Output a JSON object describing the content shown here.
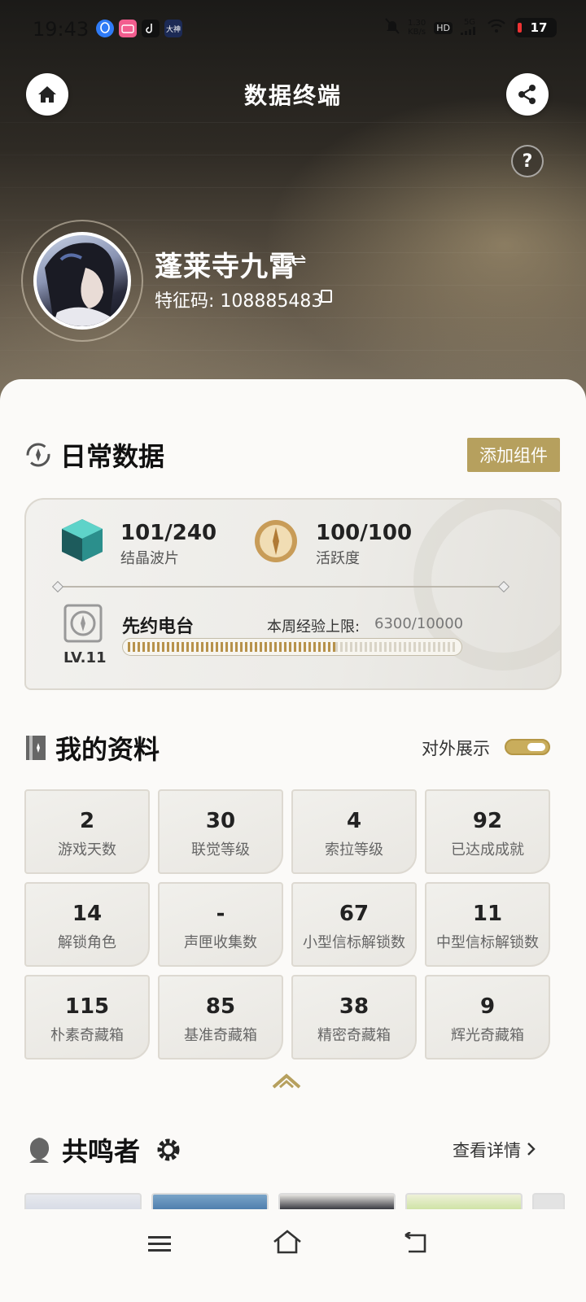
{
  "status_bar": {
    "time": "19:43",
    "net_speed_value": "1.30",
    "net_speed_unit": "KB/s",
    "hd": "HD",
    "signal": "5G",
    "battery": "17",
    "apps": [
      "qq-icon",
      "bilibili-icon",
      "tiktok-icon",
      "dashen-icon"
    ],
    "app_dashen_label": "大神"
  },
  "header": {
    "title": "数据终端",
    "help_label": "?",
    "username": "蓬莱寺九霄",
    "swap_glyph": "⇌",
    "uid_text": "特征码: 108885483"
  },
  "daily": {
    "title": "日常数据",
    "add_widget_label": "添加组件",
    "crystal_value": "101/240",
    "crystal_label": "结晶波片",
    "activity_value": "100/100",
    "activity_label": "活跃度",
    "radio_name": "先约电台",
    "weekly_exp_label": "本周经验上限:",
    "weekly_exp_value": "6300/10000",
    "weekly_exp_fraction": 0.63,
    "level": "LV.11"
  },
  "profile": {
    "title": "我的资料",
    "display_toggle_label": "对外展示",
    "display_toggle_on": true,
    "tiles": [
      {
        "value": "2",
        "label": "游戏天数"
      },
      {
        "value": "30",
        "label": "联觉等级"
      },
      {
        "value": "4",
        "label": "索拉等级"
      },
      {
        "value": "92",
        "label": "已达成成就"
      },
      {
        "value": "14",
        "label": "解锁角色"
      },
      {
        "value": "-",
        "label": "声匣收集数"
      },
      {
        "value": "67",
        "label": "小型信标解锁数"
      },
      {
        "value": "11",
        "label": "中型信标解锁数"
      },
      {
        "value": "115",
        "label": "朴素奇藏箱"
      },
      {
        "value": "85",
        "label": "基准奇藏箱"
      },
      {
        "value": "38",
        "label": "精密奇藏箱"
      },
      {
        "value": "9",
        "label": "辉光奇藏箱"
      }
    ]
  },
  "resonators": {
    "title": "共鸣者",
    "see_detail_label": "查看详情"
  },
  "colors": {
    "accent_gold": "#b6a05e",
    "toggle_gold": "#c9ad5c"
  }
}
